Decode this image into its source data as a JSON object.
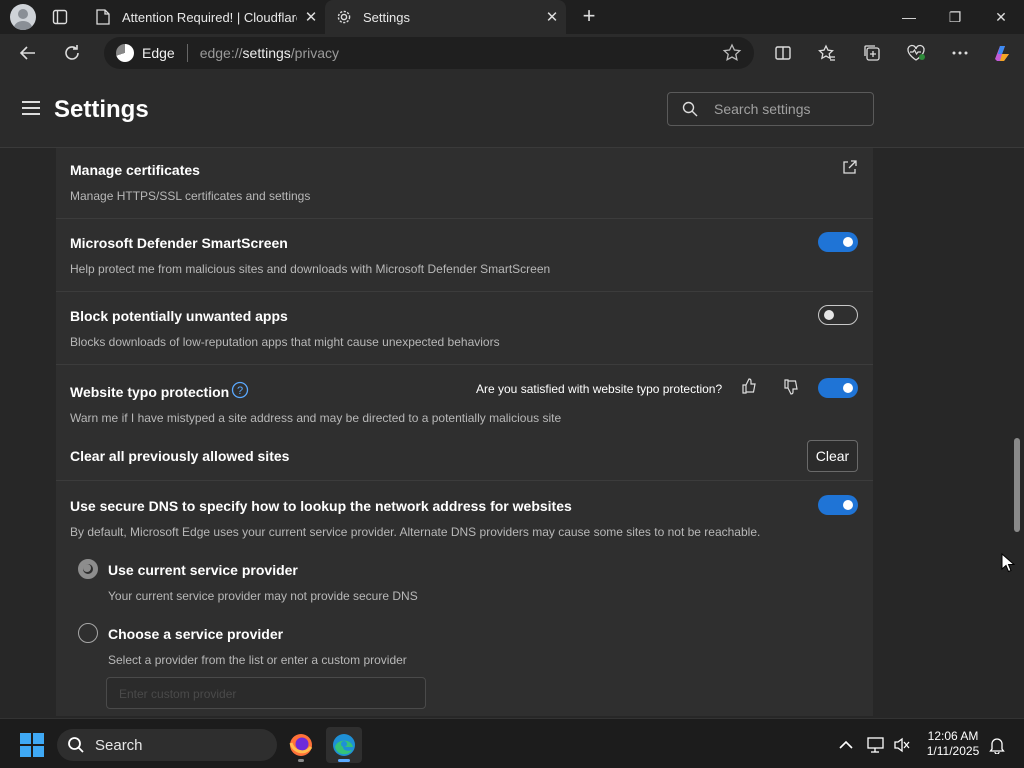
{
  "tabs": [
    {
      "title": "Attention Required! | Cloudflare",
      "close": "✕"
    },
    {
      "title": "Settings",
      "close": "✕"
    }
  ],
  "new_tab": "+",
  "window_controls": {
    "minimize": "—",
    "restore": "❐",
    "close": "✕"
  },
  "address_bar": {
    "browser_name": "Edge",
    "url_scheme": "edge://",
    "url_host": "settings",
    "url_path": "/privacy"
  },
  "settings": {
    "title": "Settings",
    "search_placeholder": "Search settings"
  },
  "sections": {
    "certificates": {
      "title": "Manage certificates",
      "desc": "Manage HTTPS/SSL certificates and settings"
    },
    "smartscreen": {
      "title": "Microsoft Defender SmartScreen",
      "desc": "Help protect me from malicious sites and downloads with Microsoft Defender SmartScreen",
      "enabled": true
    },
    "pua": {
      "title": "Block potentially unwanted apps",
      "desc": "Blocks downloads of low-reputation apps that might cause unexpected behaviors",
      "enabled": false
    },
    "typo": {
      "title": "Website typo protection",
      "feedback": "Are you satisfied with website typo protection?",
      "desc": "Warn me if I have mistyped a site address and may be directed to a potentially malicious site",
      "enabled": true
    },
    "clear_sites": {
      "title": "Clear all previously allowed sites",
      "button": "Clear"
    },
    "dns": {
      "title": "Use secure DNS to specify how to lookup the network address for websites",
      "desc": "By default, Microsoft Edge uses your current service provider. Alternate DNS providers may cause some sites to not be reachable.",
      "enabled": true,
      "options": [
        {
          "label": "Use current service provider",
          "desc": "Your current service provider may not provide secure DNS",
          "selected": true
        },
        {
          "label": "Choose a service provider",
          "desc": "Select a provider from the list or enter a custom provider",
          "selected": false
        }
      ],
      "provider_placeholder": "Enter custom provider"
    }
  },
  "taskbar": {
    "search_label": "Search",
    "time": "12:06 AM",
    "date": "1/11/2025"
  },
  "colors": {
    "accent": "#1f74d6",
    "background": "#272727",
    "card": "#2f2f2f"
  }
}
